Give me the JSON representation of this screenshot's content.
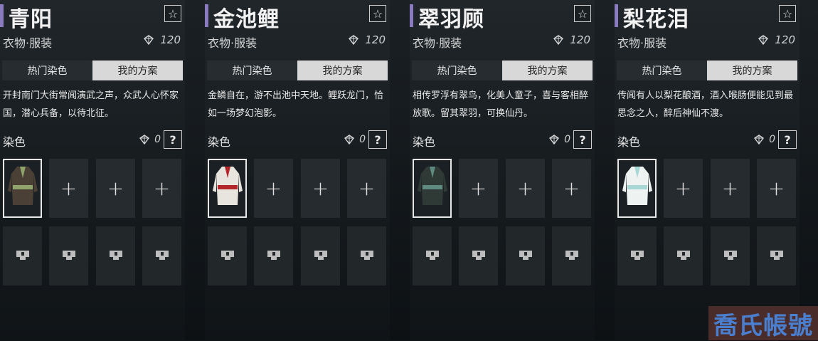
{
  "cards": [
    {
      "title": "青阳",
      "type": "衣物·服装",
      "price": "120",
      "tabs": [
        "热门染色",
        "我的方案"
      ],
      "active_tab": 1,
      "description": "开封南门大街常闻演武之声，众武人心怀家国，潜心兵备，以待北征。",
      "dye_label": "染色",
      "dye_cost": "0",
      "help_label": "?",
      "outfit_colors": {
        "body": "#4a4036",
        "accent": "#8fa36a"
      }
    },
    {
      "title": "金池鲤",
      "type": "衣物·服装",
      "price": "120",
      "tabs": [
        "热门染色",
        "我的方案"
      ],
      "active_tab": 1,
      "description": "金鳞自在，游不出池中天地。鲤跃龙门，恰如一场梦幻泡影。",
      "dye_label": "染色",
      "dye_cost": "0",
      "help_label": "?",
      "outfit_colors": {
        "body": "#e8e4de",
        "accent": "#b3262a"
      }
    },
    {
      "title": "翠羽顾",
      "type": "衣物·服装",
      "price": "120",
      "tabs": [
        "热门染色",
        "我的方案"
      ],
      "active_tab": 1,
      "description": "相传罗浮有翠鸟，化美人童子，喜与客相醉放歌。留其翠羽，可换仙丹。",
      "dye_label": "染色",
      "dye_cost": "0",
      "help_label": "?",
      "outfit_colors": {
        "body": "#2f3a36",
        "accent": "#5f8a80"
      }
    },
    {
      "title": "梨花泪",
      "type": "衣物·服装",
      "price": "120",
      "tabs": [
        "热门染色",
        "我的方案"
      ],
      "active_tab": 1,
      "description": "传闻有人以梨花酿酒，酒入喉肠便能见到最思念之人，醉后神仙不渡。",
      "dye_label": "染色",
      "dye_cost": "0",
      "help_label": "?",
      "outfit_colors": {
        "body": "#eef2f0",
        "accent": "#a8d8d6"
      }
    }
  ],
  "icons": {
    "favorite": "star-icon",
    "currency": "jade-currency-icon",
    "add": "plus-icon",
    "locked": "lock-icon"
  },
  "colors": {
    "title_accent": "#8a7bc0",
    "active_tab_bg": "#d8d8d8",
    "watermark_text": "#4a7fd0",
    "watermark_bg": "#4a2d2a"
  },
  "watermark": "喬氏帳號"
}
